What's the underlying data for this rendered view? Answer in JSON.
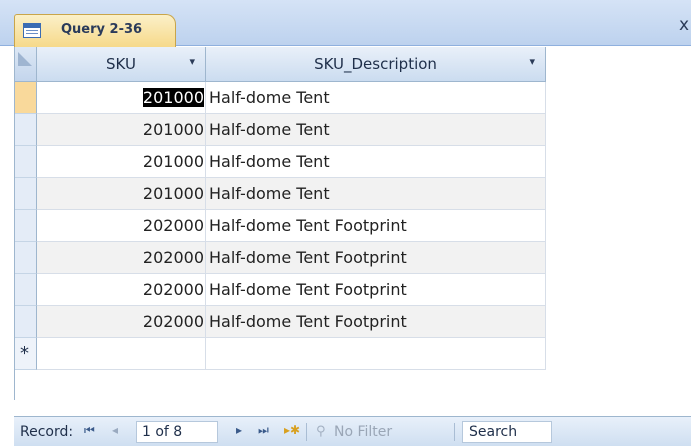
{
  "tab": {
    "title": "Query 2-36",
    "close_glyph": "x",
    "icon": "query-datasheet-icon"
  },
  "columns": [
    {
      "label": "SKU",
      "dropdown_glyph": "▾"
    },
    {
      "label": "SKU_Description",
      "dropdown_glyph": "▾"
    }
  ],
  "rows": [
    {
      "sku": "201000",
      "description": "Half-dome Tent"
    },
    {
      "sku": "201000",
      "description": "Half-dome Tent"
    },
    {
      "sku": "201000",
      "description": "Half-dome Tent"
    },
    {
      "sku": "201000",
      "description": "Half-dome Tent"
    },
    {
      "sku": "202000",
      "description": "Half-dome Tent Footprint"
    },
    {
      "sku": "202000",
      "description": "Half-dome Tent Footprint"
    },
    {
      "sku": "202000",
      "description": "Half-dome Tent Footprint"
    },
    {
      "sku": "202000",
      "description": "Half-dome Tent Footprint"
    }
  ],
  "new_record_glyph": "*",
  "navigation": {
    "record_label": "Record:",
    "first_glyph": "⏮",
    "prev_glyph": "◂",
    "position": "1 of 8",
    "next_glyph": "▸",
    "last_glyph": "⏭",
    "new_glyph": "▸✱",
    "filter_glyph": "⚲",
    "filter_label": "No Filter",
    "search_label": "Search"
  },
  "colors": {
    "tab_gold": "#f6d98a",
    "current_row": "#f9d99b",
    "header_blue": "#cbdcf0"
  }
}
